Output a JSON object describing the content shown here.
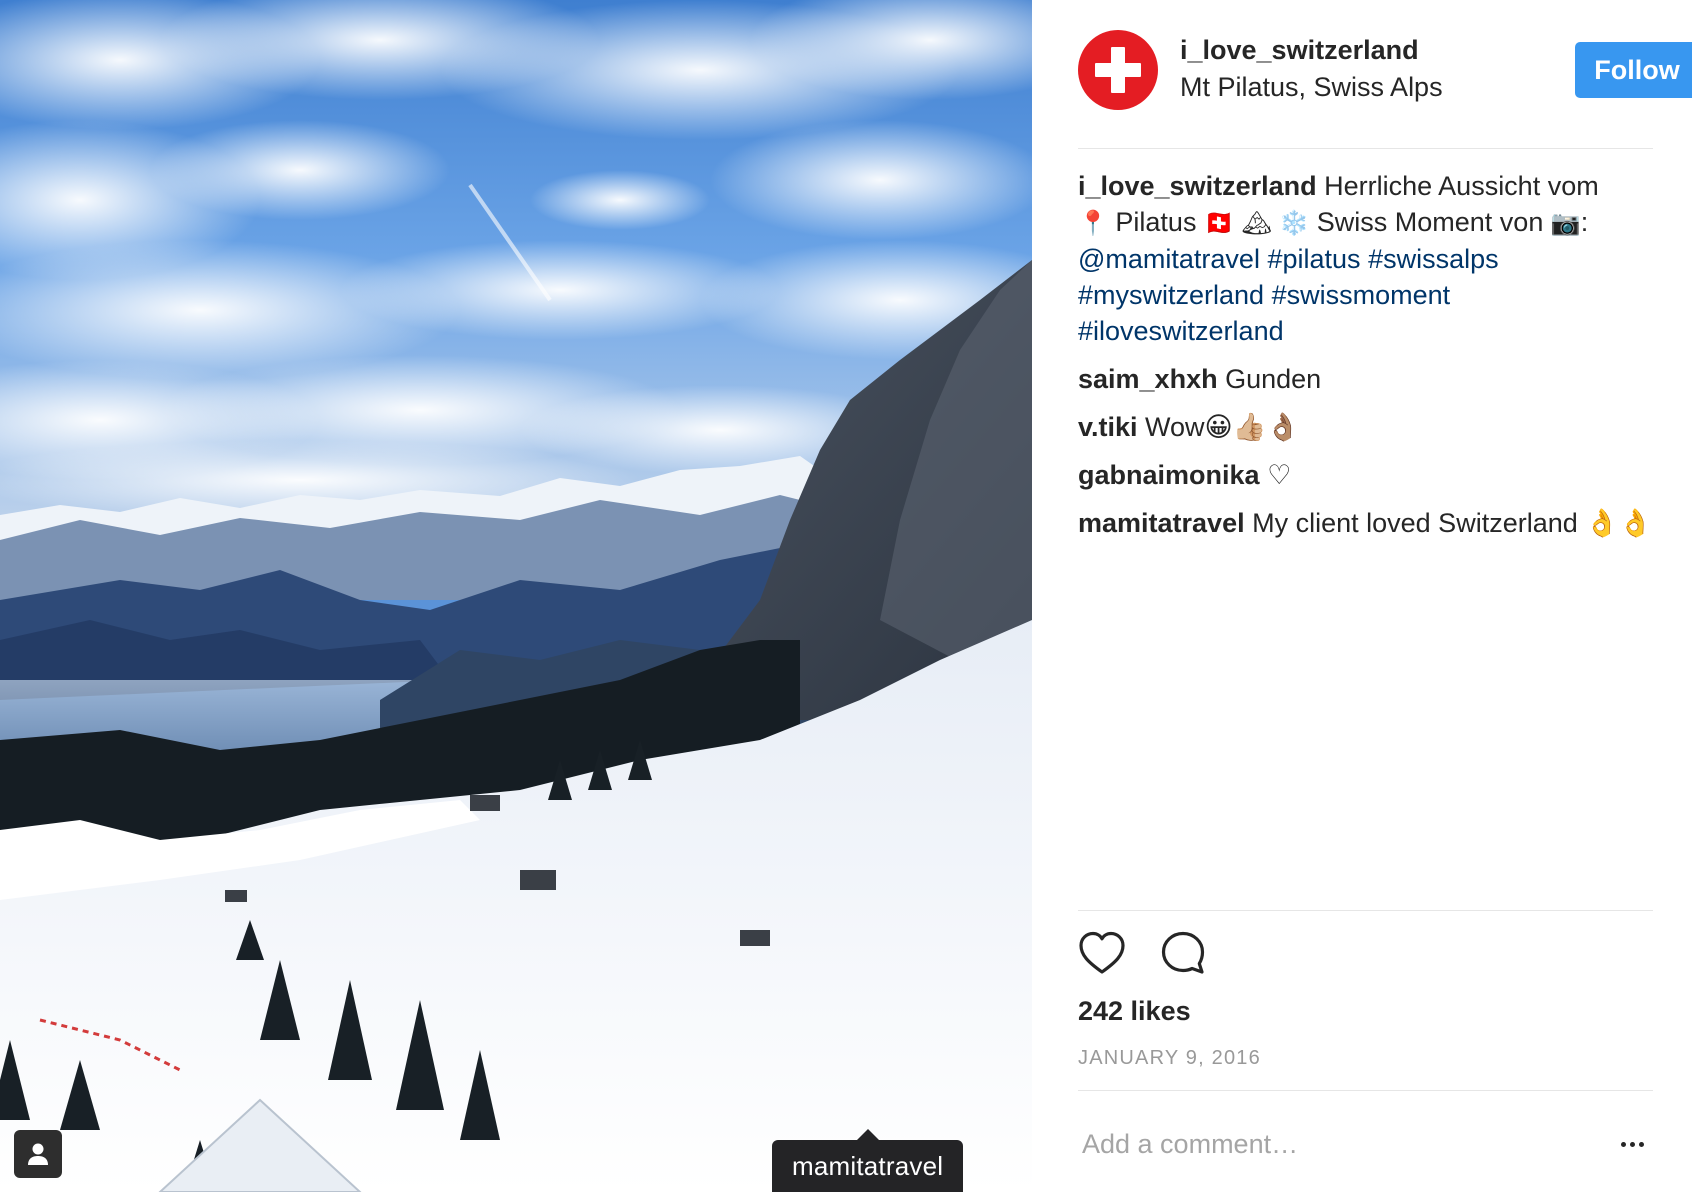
{
  "post": {
    "username": "i_love_switzerland",
    "location": "Mt Pilatus, Swiss Alps",
    "follow_label": "Follow",
    "photo_tag": "mamitatravel",
    "brand_color": "#e41d23",
    "follow_color": "#3897f0"
  },
  "caption": {
    "author": "i_love_switzerland",
    "text_1": "Herrliche Aussicht vom",
    "pin_emoji": "📍",
    "text_2": "Pilatus",
    "flag_emoji": "🇨🇭",
    "mountain_emoji": "🏔",
    "snow_emoji": "❄️",
    "text_3": "Swiss Moment von",
    "camera_emoji": "📷",
    "colon": ":",
    "mention": "@mamitatravel",
    "hashtags": [
      "#pilatus",
      "#swissalps",
      "#myswitzerland",
      "#swissmoment",
      "#iloveswitzerland"
    ]
  },
  "comments": [
    {
      "author": "saim_xhxh",
      "text": "Gunden"
    },
    {
      "author": "v.tiki",
      "text": "Wow😀👍🏼👌🏽"
    },
    {
      "author": "gabnaimonika",
      "text": "♡"
    },
    {
      "author": "mamitatravel",
      "text": "My client loved Switzerland 👌👌"
    }
  ],
  "actions": {
    "like_icon": "heart-icon",
    "comment_icon": "comment-bubble-icon"
  },
  "likes": "242 likes",
  "date": "JANUARY 9, 2016",
  "add_comment": {
    "placeholder": "Add a comment…",
    "more_icon": "more-options-icon"
  }
}
